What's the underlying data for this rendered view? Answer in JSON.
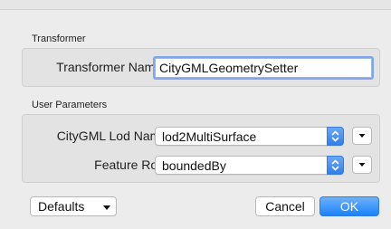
{
  "transformer_group": {
    "title": "Transformer",
    "name_label": "Transformer Name:",
    "name_value": "CityGMLGeometrySetter"
  },
  "user_parameters_group": {
    "title": "User Parameters",
    "lod_label": "CityGML Lod Name:",
    "lod_value": "lod2MultiSurface",
    "role_label": "Feature Role:",
    "role_value": "boundedBy"
  },
  "footer": {
    "defaults_label": "Defaults",
    "cancel_label": "Cancel",
    "ok_label": "OK"
  },
  "colors": {
    "accent": "#1a82fb",
    "focus_ring": "#7ea6e8",
    "panel_bg": "#ececec"
  },
  "icons": [
    "up-down-arrows-icon",
    "dropdown-triangle-icon"
  ]
}
